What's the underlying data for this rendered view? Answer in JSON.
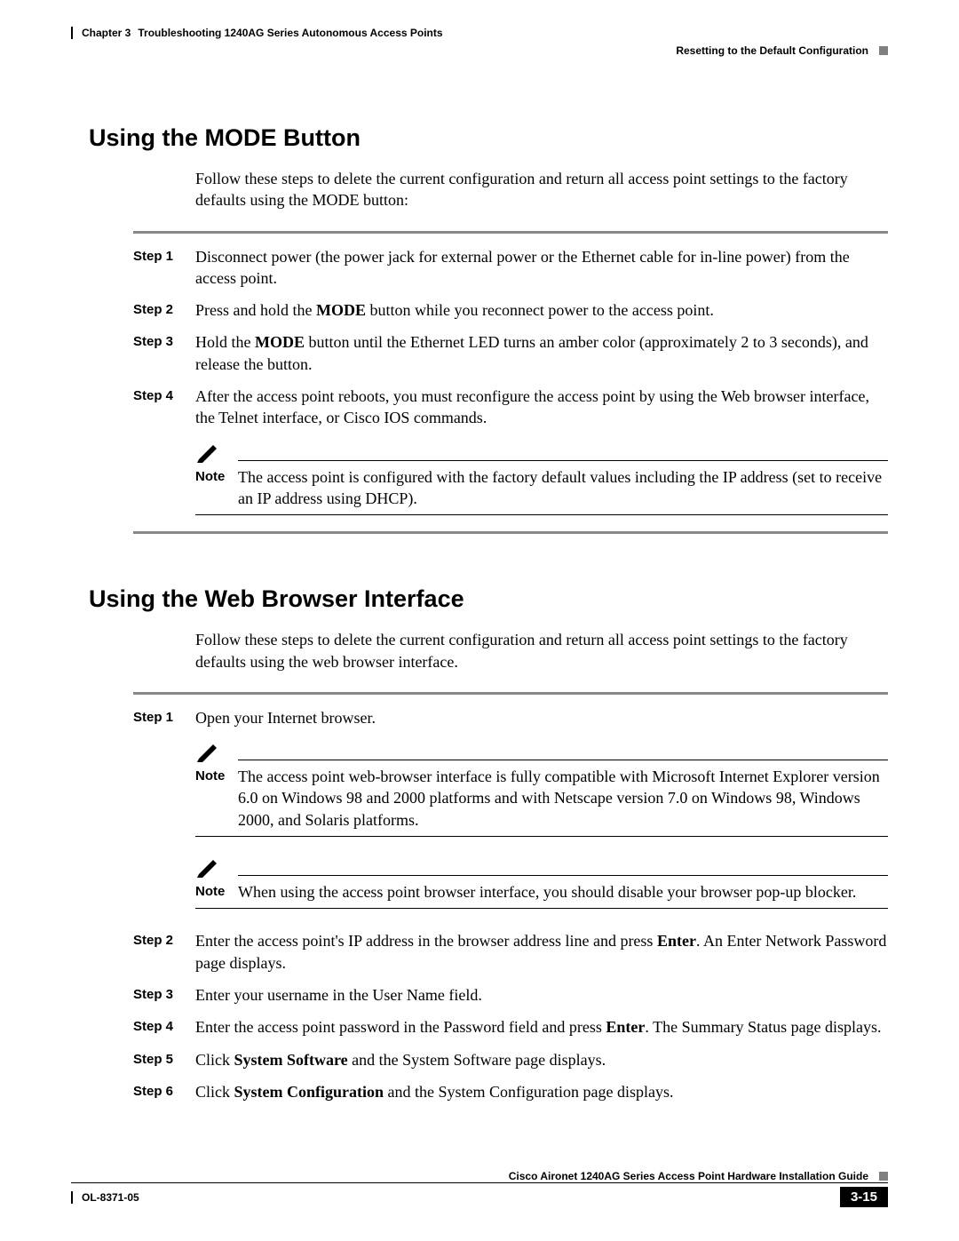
{
  "header": {
    "chapter_label": "Chapter 3",
    "chapter_title": "Troubleshooting 1240AG Series Autonomous Access Points",
    "section_title": "Resetting to the Default Configuration"
  },
  "section1": {
    "title": "Using the MODE Button",
    "intro": "Follow these steps to delete the current configuration and return all access point settings to the factory defaults using the MODE button:",
    "steps": {
      "s1_label": "Step 1",
      "s1_text": "Disconnect power (the power jack for external power or the Ethernet cable for in-line power) from the access point.",
      "s2_label": "Step 2",
      "s2_pre": "Press and hold the ",
      "s2_bold": "MODE",
      "s2_post": " button while you reconnect power to the access point.",
      "s3_label": "Step 3",
      "s3_pre": "Hold the ",
      "s3_bold": "MODE",
      "s3_post": " button until the Ethernet LED turns an amber color (approximately 2 to 3 seconds), and release the button.",
      "s4_label": "Step 4",
      "s4_text": "After the access point reboots, you must reconfigure the access point by using the Web browser interface, the Telnet interface, or Cisco IOS commands."
    },
    "note": {
      "label": "Note",
      "text": "The access point is configured with the factory default values including the IP address (set to receive an IP address using DHCP)."
    }
  },
  "section2": {
    "title": "Using the Web Browser Interface",
    "intro": "Follow these steps to delete the current configuration and return all access point settings to the factory defaults using the web browser interface.",
    "steps": {
      "s1_label": "Step 1",
      "s1_text": "Open your Internet browser.",
      "s2_label": "Step 2",
      "s2_pre": "Enter the access point's IP address in the browser address line and press ",
      "s2_bold": "Enter",
      "s2_post": ". An Enter Network Password page displays.",
      "s3_label": "Step 3",
      "s3_text": "Enter your username in the User Name field.",
      "s4_label": "Step 4",
      "s4_pre": "Enter the access point password in the Password field and press ",
      "s4_bold": "Enter",
      "s4_post": ". The Summary Status page displays.",
      "s5_label": "Step 5",
      "s5_pre": "Click ",
      "s5_bold": "System Software",
      "s5_post": " and the System Software page displays.",
      "s6_label": "Step 6",
      "s6_pre": "Click ",
      "s6_bold": "System Configuration",
      "s6_post": " and the System Configuration page displays."
    },
    "note1": {
      "label": "Note",
      "text": "The access point web-browser interface is fully compatible with Microsoft Internet Explorer version 6.0 on Windows 98 and 2000 platforms and with Netscape version 7.0 on Windows 98, Windows 2000, and Solaris platforms."
    },
    "note2": {
      "label": "Note",
      "text": "When using the access point browser interface, you should disable your browser pop-up blocker."
    }
  },
  "footer": {
    "guide_title": "Cisco Aironet 1240AG Series Access Point Hardware Installation Guide",
    "doc_id": "OL-8371-05",
    "page_number": "3-15"
  }
}
